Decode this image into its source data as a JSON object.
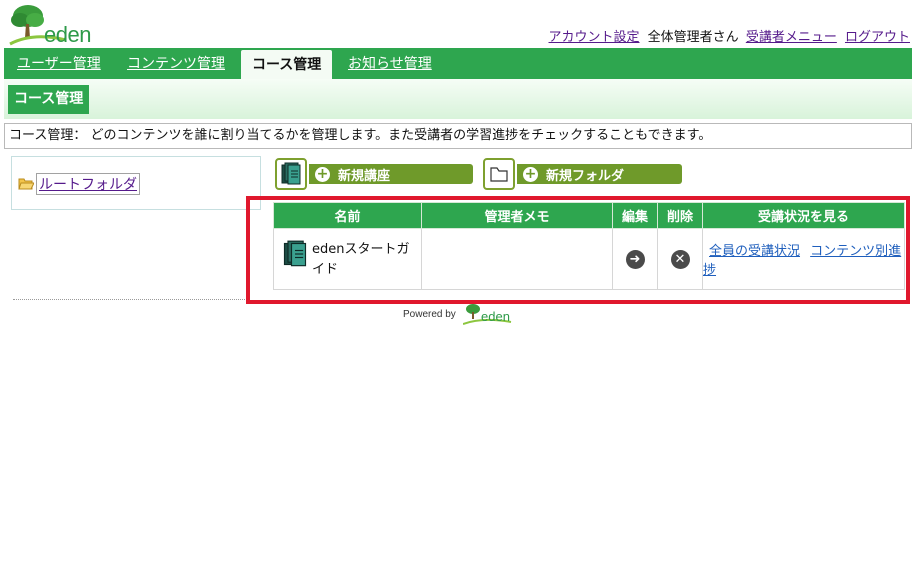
{
  "brand": {
    "logo_text": "eden",
    "primary_color": "#2ea64f",
    "highlight_color": "#e0182d"
  },
  "top_nav": {
    "account_settings": "アカウント設定",
    "user_label": "全体管理者さん",
    "learner_menu": "受講者メニュー",
    "logout": "ログアウト"
  },
  "main_tabs": [
    {
      "label": "ユーザー管理",
      "active": false
    },
    {
      "label": "コンテンツ管理",
      "active": false
    },
    {
      "label": "コース管理",
      "active": true
    },
    {
      "label": "お知らせ管理",
      "active": false
    }
  ],
  "sub_tab": {
    "label": "コース管理"
  },
  "description": "コース管理： どのコンテンツを誰に割り当てるかを管理します。また受講者の学習進捗をチェックすることもできます。",
  "folder_tree": {
    "root_label": "ルートフォルダ",
    "icon": "open-folder-icon"
  },
  "actions": {
    "new_course_label": "新規講座",
    "new_folder_label": "新規フォルダ",
    "new_course_icon": "book-stack-icon",
    "new_folder_icon": "folder-outline-icon"
  },
  "table": {
    "headers": [
      "名前",
      "管理者メモ",
      "編集",
      "削除",
      "受講状況を見る"
    ],
    "rows": [
      {
        "name": "edenスタートガイド",
        "memo": "",
        "edit_icon": "arrow-right-circle-icon",
        "delete_icon": "close-circle-icon",
        "status_all": "全員の受講状況",
        "status_by_content": "コンテンツ別進捗"
      }
    ]
  },
  "footer": {
    "powered_by": "Powered by",
    "logo_text": "eden"
  }
}
